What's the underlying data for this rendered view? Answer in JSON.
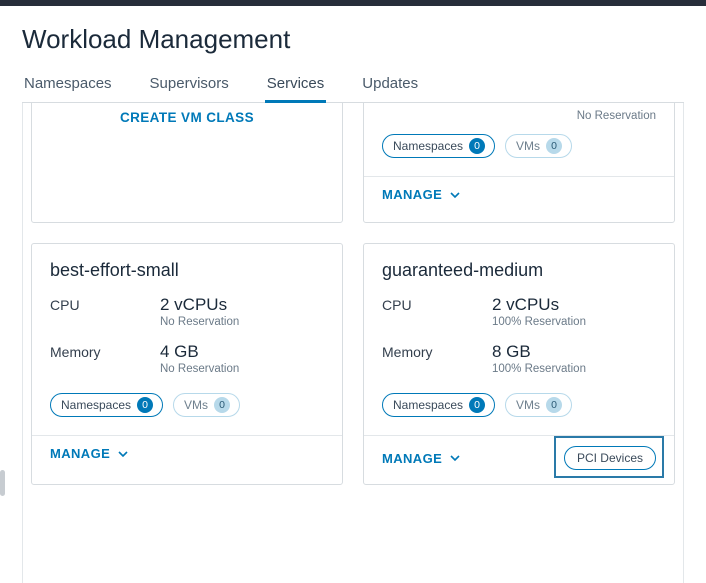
{
  "header": {
    "title": "Workload Management"
  },
  "tabs": {
    "items": [
      "Namespaces",
      "Supervisors",
      "Services",
      "Updates"
    ],
    "active": 2
  },
  "labels": {
    "create_vm_class": "CREATE VM CLASS",
    "manage": "MANAGE",
    "namespaces": "Namespaces",
    "vms": "VMs",
    "cpu": "CPU",
    "memory": "Memory",
    "pci_devices": "PCI Devices",
    "no_reservation": "No Reservation",
    "full_reservation": "100% Reservation"
  },
  "partial_card": {
    "namespaces_count": 0,
    "vms_count": 0
  },
  "cards": [
    {
      "name": "best-effort-small",
      "cpu_value": "2 vCPUs",
      "cpu_sub": "No Reservation",
      "mem_value": "4 GB",
      "mem_sub": "No Reservation",
      "namespaces_count": 0,
      "vms_count": 0,
      "pci": false
    },
    {
      "name": "guaranteed-medium",
      "cpu_value": "2 vCPUs",
      "cpu_sub": "100% Reservation",
      "mem_value": "8 GB",
      "mem_sub": "100% Reservation",
      "namespaces_count": 0,
      "vms_count": 0,
      "pci": true
    }
  ]
}
